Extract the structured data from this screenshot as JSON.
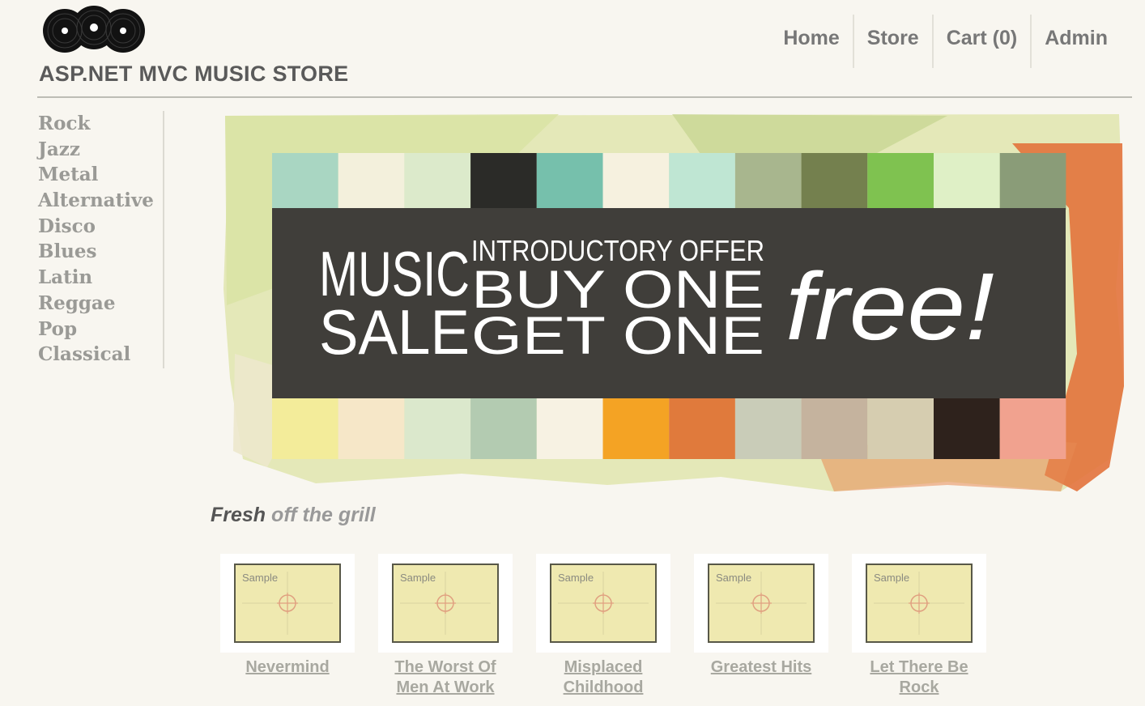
{
  "site": {
    "title": "ASP.NET MVC MUSIC STORE"
  },
  "nav": {
    "items": [
      {
        "label": "Home",
        "name": "nav-home"
      },
      {
        "label": "Store",
        "name": "nav-store"
      },
      {
        "label": "Cart (0)",
        "name": "nav-cart"
      },
      {
        "label": "Admin",
        "name": "nav-admin"
      }
    ]
  },
  "genres": [
    "Rock",
    "Jazz",
    "Metal",
    "Alternative",
    "Disco",
    "Blues",
    "Latin",
    "Reggae",
    "Pop",
    "Classical"
  ],
  "banner": {
    "line_music": "MUSIC",
    "line_sale": "SALE",
    "line_intro": "INTRODUCTORY OFFER",
    "line_buy": "BUY ONE",
    "line_get": "GET ONE",
    "line_free": "free!"
  },
  "fresh": {
    "lead": "Fresh",
    "rest": "off the grill"
  },
  "albums": [
    {
      "title": "Nevermind",
      "thumb_label": "Sample"
    },
    {
      "title": "The Worst Of Men At Work",
      "thumb_label": "Sample"
    },
    {
      "title": "Misplaced Childhood",
      "thumb_label": "Sample"
    },
    {
      "title": "Greatest Hits",
      "thumb_label": "Sample"
    },
    {
      "title": "Let There Be Rock",
      "thumb_label": "Sample"
    }
  ],
  "colors": {
    "background": "#f8f6f0",
    "banner_panel": "#403e3a",
    "thumb_fill": "#efe9b0"
  }
}
